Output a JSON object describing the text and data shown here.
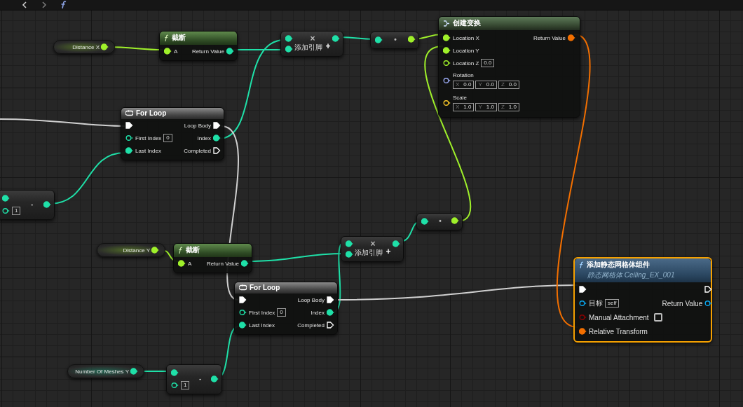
{
  "nodes": [
    {
      "kind": "variable",
      "title": "Distance X",
      "selected": false,
      "outputs": [
        {
          "kind": "float",
          "connected": true
        }
      ]
    },
    {
      "kind": "function",
      "title": "截断",
      "selected": false,
      "inputs": [
        {
          "label": "A",
          "kind": "float",
          "connected": true
        }
      ],
      "outputs": [
        {
          "label": "Return Value",
          "kind": "int",
          "connected": true
        }
      ]
    },
    {
      "kind": "operator",
      "symbol": "×",
      "add_pin": "添加引脚",
      "add_icon": "+",
      "selected": false,
      "inputs": [
        {
          "kind": "int",
          "connected": true
        },
        {
          "kind": "int",
          "connected": true
        }
      ],
      "outputs": [
        {
          "kind": "int",
          "connected": true
        }
      ]
    },
    {
      "kind": "operator",
      "symbol": "•",
      "selected": false,
      "inputs": [
        {
          "kind": "int",
          "connected": true
        }
      ],
      "outputs": [
        {
          "kind": "float",
          "connected": true
        }
      ]
    },
    {
      "kind": "struct",
      "title": "创建变换",
      "selected": false,
      "inputs": [
        {
          "label": "Location X",
          "kind": "float",
          "connected": true
        },
        {
          "label": "Location Y",
          "kind": "float",
          "connected": true
        },
        {
          "label": "Location Z",
          "kind": "float",
          "connected": false,
          "value": "0.0"
        },
        {
          "label": "Rotation",
          "kind": "rotator",
          "connected": false,
          "fields": [
            {
              "axis": "X",
              "value": "0.0"
            },
            {
              "axis": "Y",
              "value": "0.0"
            },
            {
              "axis": "Z",
              "value": "0.0"
            }
          ]
        },
        {
          "label": "Scale",
          "kind": "vector",
          "connected": false,
          "fields": [
            {
              "axis": "X",
              "value": "1.0"
            },
            {
              "axis": "Y",
              "value": "1.0"
            },
            {
              "axis": "Z",
              "value": "1.0"
            }
          ]
        }
      ],
      "outputs": [
        {
          "label": "Return Value",
          "kind": "transform",
          "connected": true
        }
      ]
    },
    {
      "kind": "loop",
      "title": "For Loop",
      "selected": false,
      "inputs": [
        {
          "kind": "exec",
          "connected": true
        },
        {
          "label": "First Index",
          "kind": "int",
          "connected": false,
          "value": "0"
        },
        {
          "label": "Last Index",
          "kind": "int",
          "connected": true
        }
      ],
      "outputs": [
        {
          "label": "Loop Body",
          "kind": "exec",
          "connected": true
        },
        {
          "label": "Index",
          "kind": "int",
          "connected": true
        },
        {
          "label": "Completed",
          "kind": "exec",
          "connected": false
        }
      ]
    },
    {
      "kind": "operator",
      "symbol": "-",
      "selected": false,
      "inputs": [
        {
          "kind": "int",
          "connected": true
        },
        {
          "kind": "int",
          "connected": false,
          "value": "1"
        }
      ],
      "outputs": [
        {
          "kind": "int",
          "connected": true
        }
      ]
    },
    {
      "kind": "operator",
      "symbol": "•",
      "selected": false,
      "inputs": [
        {
          "kind": "int",
          "connected": true
        }
      ],
      "outputs": [
        {
          "kind": "float",
          "connected": true
        }
      ]
    },
    {
      "kind": "variable",
      "title": "Distance Y",
      "selected": false,
      "outputs": [
        {
          "kind": "float",
          "connected": true
        }
      ]
    },
    {
      "kind": "function",
      "title": "截断",
      "selected": false,
      "inputs": [
        {
          "label": "A",
          "kind": "float",
          "connected": true
        }
      ],
      "outputs": [
        {
          "label": "Return Value",
          "kind": "int",
          "connected": true
        }
      ]
    },
    {
      "kind": "operator",
      "symbol": "×",
      "add_pin": "添加引脚",
      "add_icon": "+",
      "selected": false,
      "inputs": [
        {
          "kind": "int",
          "connected": true
        },
        {
          "kind": "int",
          "connected": true
        }
      ],
      "outputs": [
        {
          "kind": "int",
          "connected": true
        }
      ]
    },
    {
      "kind": "loop",
      "title": "For Loop",
      "selected": false,
      "inputs": [
        {
          "kind": "exec",
          "connected": true
        },
        {
          "label": "First Index",
          "kind": "int",
          "connected": false,
          "value": "0"
        },
        {
          "label": "Last Index",
          "kind": "int",
          "connected": true
        }
      ],
      "outputs": [
        {
          "label": "Loop Body",
          "kind": "exec",
          "connected": true
        },
        {
          "label": "Index",
          "kind": "int",
          "connected": true
        },
        {
          "label": "Completed",
          "kind": "exec",
          "connected": false
        }
      ]
    },
    {
      "kind": "call",
      "title": "添加静态网格体组件",
      "subtitle": "静态网格体 Ceiling_EX_001",
      "selected": true,
      "inputs": [
        {
          "kind": "exec",
          "connected": true
        },
        {
          "label": "目标",
          "kind": "object",
          "connected": false,
          "value": "self"
        },
        {
          "label": "Manual Attachment",
          "kind": "bool",
          "connected": false,
          "checkbox": {
            "checked": false
          }
        },
        {
          "label": "Relative Transform",
          "kind": "transform",
          "connected": true
        }
      ],
      "outputs": [
        {
          "kind": "exec",
          "connected": false
        },
        {
          "label": "Return Value",
          "kind": "object",
          "connected": false
        }
      ]
    },
    {
      "kind": "variable",
      "title": "Number Of Meshes Y",
      "selected": false,
      "outputs": [
        {
          "kind": "int",
          "connected": true
        }
      ]
    },
    {
      "kind": "operator",
      "symbol": "-",
      "selected": false,
      "inputs": [
        {
          "kind": "int",
          "connected": true
        },
        {
          "kind": "int",
          "connected": false,
          "value": "1"
        }
      ],
      "outputs": [
        {
          "kind": "int",
          "connected": true
        }
      ]
    }
  ]
}
